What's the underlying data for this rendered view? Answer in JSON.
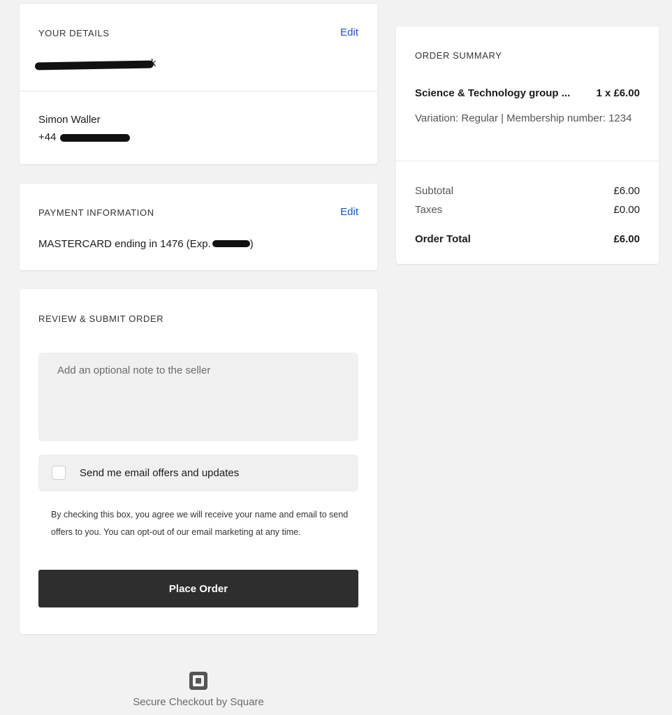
{
  "details": {
    "heading": "YOUR DETAILS",
    "edit_label": "Edit",
    "email_visible": "k",
    "name": "Simon Waller",
    "phone_prefix": "+44"
  },
  "payment": {
    "heading": "PAYMENT INFORMATION",
    "edit_label": "Edit",
    "card_text": "MASTERCARD ending in 1476 (Exp.",
    "card_text_close": ")"
  },
  "review": {
    "heading": "REVIEW & SUBMIT ORDER",
    "note_placeholder": "Add an optional note to the seller",
    "optin_label": "Send me email offers and updates",
    "disclaimer": "By checking this box, you agree we will receive your name and email to send offers to you. You can opt-out of our email marketing at any time.",
    "place_order_label": "Place Order"
  },
  "summary": {
    "heading": "ORDER SUMMARY",
    "item_name": "Science & Technology group ...",
    "item_qty_price": "1 x £6.00",
    "item_variation": "Variation: Regular | Membership number: 1234",
    "subtotal_label": "Subtotal",
    "subtotal_value": "£6.00",
    "taxes_label": "Taxes",
    "taxes_value": "£0.00",
    "total_label": "Order Total",
    "total_value": "£6.00"
  },
  "footer": {
    "icon": "square-logo-icon",
    "text": "Secure Checkout by Square"
  }
}
